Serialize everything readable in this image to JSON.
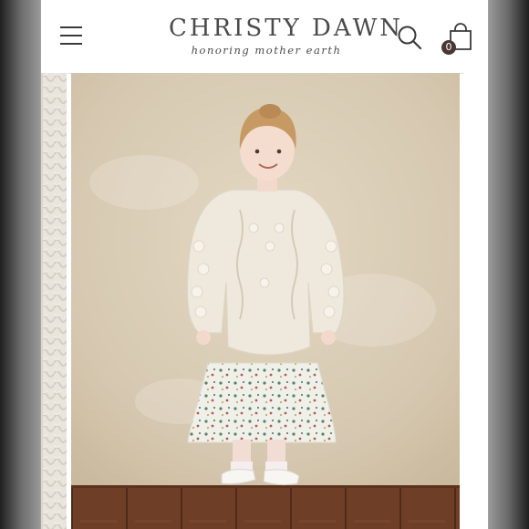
{
  "header": {
    "menu_icon": "hamburger-menu-icon",
    "brand_name": "CHRISTY DAWN",
    "brand_tagline": "honoring mother earth",
    "search_icon": "search-icon",
    "cart_icon": "shopping-bag-icon",
    "cart_count": "0"
  },
  "gallery": {
    "main_image": "child in cream cable-knit bobble sweater and floral skirt",
    "colors": {
      "backdrop": "#d9ccb5",
      "sweater": "#efe9dd",
      "floor": "#6e3f26"
    }
  }
}
